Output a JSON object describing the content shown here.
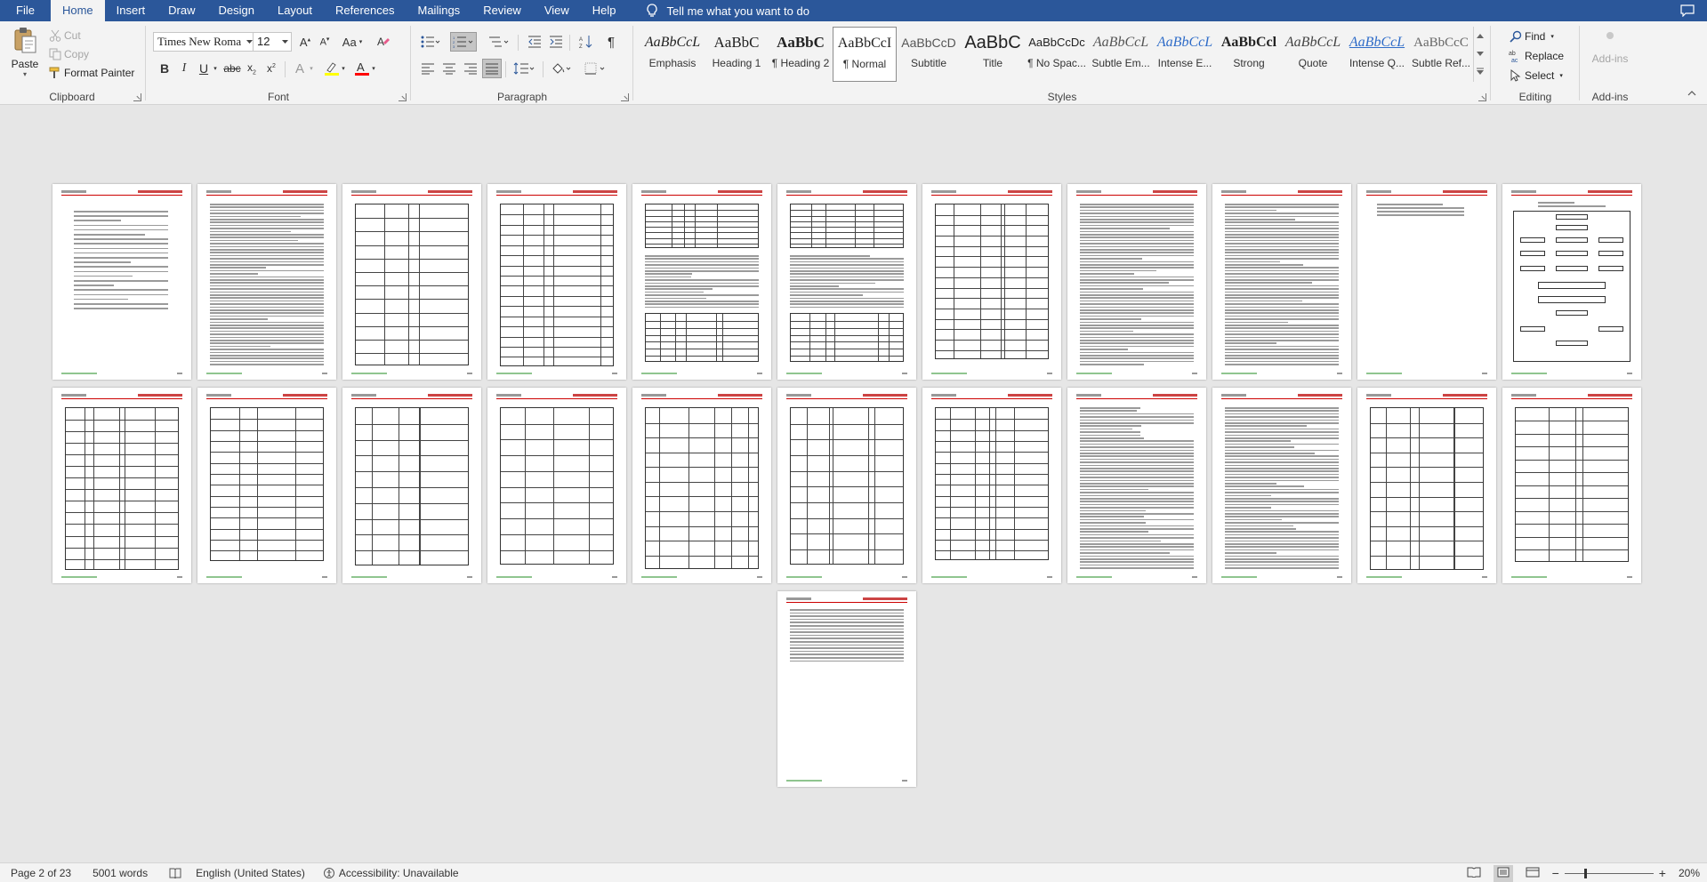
{
  "tabs": {
    "file": "File",
    "home": "Home",
    "insert": "Insert",
    "draw": "Draw",
    "design": "Design",
    "layout": "Layout",
    "references": "References",
    "mailings": "Mailings",
    "review": "Review",
    "view": "View",
    "help": "Help",
    "tell_me": "Tell me what you want to do"
  },
  "clipboard": {
    "paste": "Paste",
    "cut": "Cut",
    "copy": "Copy",
    "format_painter": "Format Painter",
    "label": "Clipboard"
  },
  "font": {
    "family": "Times New Roma",
    "size": "12",
    "label": "Font",
    "case_label": "Aa"
  },
  "paragraph": {
    "label": "Paragraph"
  },
  "styles": {
    "label": "Styles",
    "items": [
      {
        "preview": "AaBbCcL",
        "name": "Emphasis"
      },
      {
        "preview": "AaBbC",
        "name": "Heading 1"
      },
      {
        "preview": "AaBbC",
        "name": "¶ Heading 2"
      },
      {
        "preview": "AaBbCcI",
        "name": "¶ Normal"
      },
      {
        "preview": "AaBbCcD",
        "name": "Subtitle"
      },
      {
        "preview": "AaBbC",
        "name": "Title"
      },
      {
        "preview": "AaBbCcDc",
        "name": "¶ No Spac..."
      },
      {
        "preview": "AaBbCcL",
        "name": "Subtle Em..."
      },
      {
        "preview": "AaBbCcL",
        "name": "Intense E..."
      },
      {
        "preview": "AaBbCcl",
        "name": "Strong"
      },
      {
        "preview": "AaBbCcL",
        "name": "Quote"
      },
      {
        "preview": "AaBbCcL",
        "name": "Intense Q..."
      },
      {
        "preview": "AaBbCcC",
        "name": "Subtle Ref..."
      }
    ]
  },
  "editing": {
    "find": "Find",
    "replace": "Replace",
    "select": "Select",
    "label": "Editing"
  },
  "addins": {
    "button": "Add-ins",
    "label": "Add-ins"
  },
  "status": {
    "page": "Page 2 of 23",
    "words": "5001 words",
    "language": "English (United States)",
    "accessibility": "Accessibility: Unavailable",
    "zoom": "20%"
  },
  "colors": {
    "accent": "#2b579a",
    "highlight": "#ffff00",
    "font_color": "#ff0000"
  }
}
